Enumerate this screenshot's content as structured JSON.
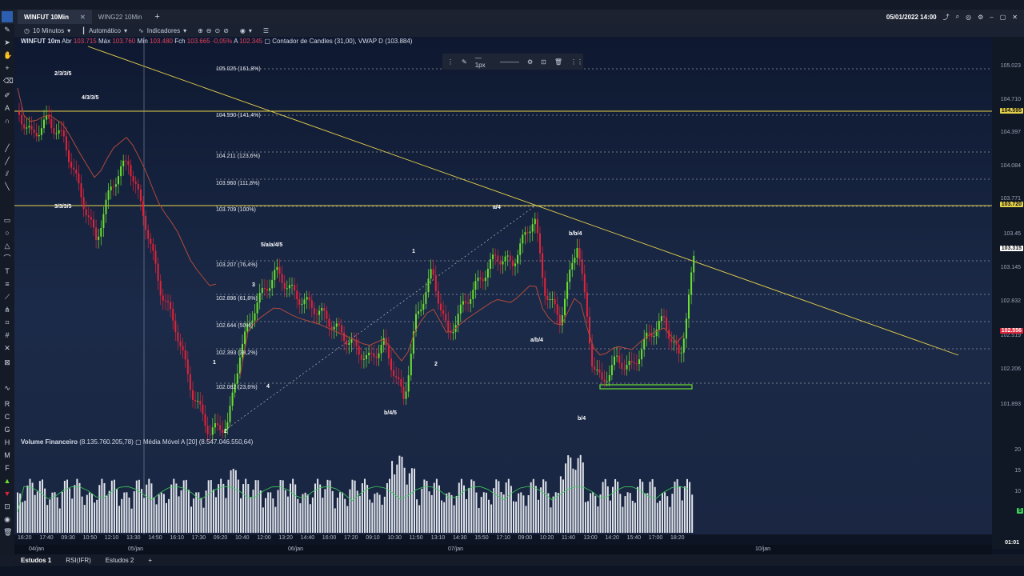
{
  "tabs": [
    {
      "label": "WINFUT 10Min",
      "active": true
    },
    {
      "label": "WING22 10Min",
      "active": false
    }
  ],
  "top_right": {
    "datetime": "05/01/2022 14:00"
  },
  "toolbar": {
    "timeframe": "10 Minutos",
    "scale": "Automático",
    "indicators": "Indicadores"
  },
  "header": {
    "symbol": "WINFUT 10m",
    "abr_label": "Abr",
    "abr": "103.715",
    "max_label": "Máx",
    "max": "103.760",
    "min_label": "Mín",
    "min": "103.480",
    "fch_label": "Fch",
    "fch": "103.665",
    "change": "-0,05%",
    "a_label": "A",
    "a": "102.345",
    "indicator": "Contador de Candles",
    "indicator_val": "(31,00),",
    "vwap": "VWAP D",
    "vwap_val": "(103.884)"
  },
  "volume_header": {
    "label": "Volume Financeiro",
    "value": "(8.135.760.205,78)",
    "ma": "Média Móvel A [20]",
    "ma_val": "(8.547.046.550,64)"
  },
  "floating_toolbar": {
    "width_label": "1px"
  },
  "fib_levels": [
    {
      "label": "105.025 (161,8%)"
    },
    {
      "label": "104.590 (141,4%)"
    },
    {
      "label": "104.211 (123,6%)"
    },
    {
      "label": "103.960 (111,8%)"
    },
    {
      "label": "103.709 (100%)"
    },
    {
      "label": "103.207 (76,4%)"
    },
    {
      "label": "102.896 (61,8%)"
    },
    {
      "label": "102.644 (50%)"
    },
    {
      "label": "102.393 (38,2%)"
    },
    {
      "label": "102.082 (23,6%)"
    }
  ],
  "price_axis": [
    "105.023",
    "104.710",
    "104.397",
    "104.084",
    "103.771",
    "103.45",
    "103.145",
    "102.832",
    "102.519",
    "102.206",
    "101.893"
  ],
  "price_badges": {
    "yellow1": "104.595",
    "yellow2": "103.720",
    "current": "103.315",
    "red": "102.556"
  },
  "volume_axis": [
    "20",
    "15",
    "10",
    "5"
  ],
  "wave_labels": [
    "2/3/3/5",
    "4/3/3/5",
    "3/3/3/5",
    "5/a/a/4/5",
    "1",
    "3",
    "1",
    "2",
    "4",
    "2",
    "b/4/5",
    "a/4",
    "b/b/4",
    "a/b/4",
    "b/4",
    "2"
  ],
  "time_labels": [
    "16:20",
    "17:40",
    "09:30",
    "10:50",
    "12:10",
    "13:30",
    "14:50",
    "16:10",
    "17:30",
    "09:20",
    "10:40",
    "12:00",
    "13:20",
    "14:40",
    "16:00",
    "17:20",
    "09:10",
    "10:30",
    "11:50",
    "13:10",
    "14:30",
    "15:50",
    "17:10",
    "09:00",
    "10:20",
    "11:40",
    "13:00",
    "14:20",
    "15:40",
    "17:00",
    "18:20"
  ],
  "date_labels": [
    "04/jan",
    "05/jan",
    "06/jan",
    "07/jan",
    "10/jan"
  ],
  "date_axis_right": "01:01",
  "bottom_tabs": [
    "Estudos 1",
    "RSI(IFR)",
    "Estudos 2"
  ],
  "colors": {
    "bull": "#6be030",
    "bear": "#e0243a",
    "fib_yellow": "#e6d24a",
    "ma_red": "#b04a3a"
  }
}
